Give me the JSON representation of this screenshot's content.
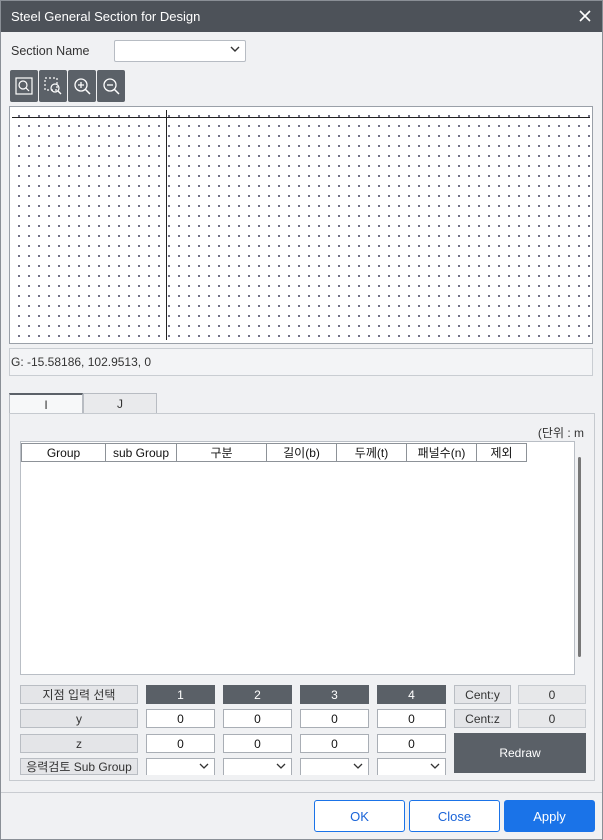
{
  "window": {
    "title": "Steel General Section for Design"
  },
  "section": {
    "label": "Section Name",
    "value": ""
  },
  "toolbar": [
    "zoom-fit-icon",
    "zoom-window-icon",
    "zoom-in-icon",
    "zoom-out-icon"
  ],
  "status": {
    "coord": "G: -15.58186, 102.9513, 0"
  },
  "tabs": [
    {
      "label": "I",
      "active": true
    },
    {
      "label": "J",
      "active": false
    }
  ],
  "unit": "(단위 : m",
  "table": {
    "columns": [
      "Group",
      "sub Group",
      "구분",
      "길이(b)",
      "두께(t)",
      "패널수(n)",
      "제외"
    ],
    "rows": []
  },
  "points": {
    "select_label": "지점 입력 선택",
    "y_label": "y",
    "z_label": "z",
    "subgroup_label": "응력검토 Sub Group",
    "numbers": [
      "1",
      "2",
      "3",
      "4"
    ],
    "y": [
      "0",
      "0",
      "0",
      "0"
    ],
    "z": [
      "0",
      "0",
      "0",
      "0"
    ]
  },
  "centroid": {
    "y_label": "Cent:y",
    "y_value": "0",
    "z_label": "Cent:z",
    "z_value": "0"
  },
  "redraw_label": "Redraw",
  "footer": {
    "ok": "OK",
    "close": "Close",
    "apply": "Apply"
  },
  "colors": {
    "titlebar": "#4d5259",
    "dark_button": "#5a6067",
    "primary": "#1a73e8"
  }
}
